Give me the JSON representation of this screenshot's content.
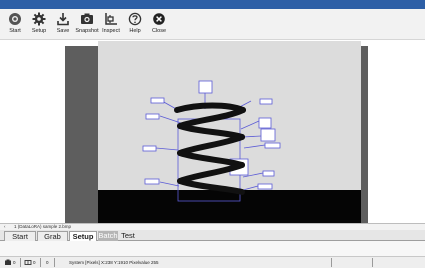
{
  "toolbar": {
    "buttons": [
      {
        "id": "start",
        "label": "Start",
        "icon": "sun-gear-icon"
      },
      {
        "id": "setup",
        "label": "Setup",
        "icon": "gear-icon"
      },
      {
        "id": "save",
        "label": "Save",
        "icon": "download-tray-icon"
      },
      {
        "id": "snapshot",
        "label": "Snapshot",
        "icon": "camera-icon"
      },
      {
        "id": "inspect",
        "label": "Inspect",
        "icon": "inspect-chart-icon"
      },
      {
        "id": "help",
        "label": "Help",
        "icon": "question-circle-icon"
      },
      {
        "id": "close",
        "label": "Close",
        "icon": "close-circle-icon"
      }
    ]
  },
  "file": {
    "name": "1 (DataLoRA) sample 2.bmp"
  },
  "tabs": [
    {
      "label": "Start",
      "state": "normal"
    },
    {
      "label": "Grab",
      "state": "normal"
    },
    {
      "label": "Setup",
      "state": "active"
    },
    {
      "label": "Batch",
      "state": "dim"
    },
    {
      "label": "Test",
      "state": "plain"
    }
  ],
  "status": {
    "count_a": "0",
    "count_b": "0",
    "count_c": "0",
    "text": "System   [Pixels] X:238 Y:1910 Pixelvalue 255"
  },
  "colors": {
    "titlebar": "#2d5fa6",
    "viewer_bg": "#5e5e5e",
    "image_bg": "#dcdcdc",
    "annotation": "#5b5bd6",
    "spring": "#111111"
  }
}
